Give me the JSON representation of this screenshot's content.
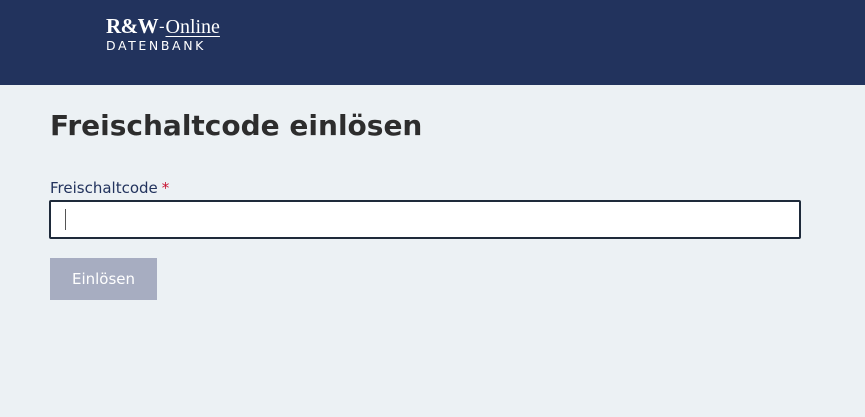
{
  "header": {
    "logo": {
      "mark": "R&W",
      "dash": "-",
      "online": "Online",
      "subtitle": "DATENBANK"
    },
    "background_color": "#22335d"
  },
  "main": {
    "title": "Freischaltcode einlösen",
    "form": {
      "code_label": "Freischaltcode",
      "required_marker": "*",
      "code_value": "",
      "code_placeholder": "",
      "submit_label": "Einlösen",
      "submit_disabled": true
    }
  },
  "colors": {
    "page_background": "#ecf1f4",
    "label_color": "#22335d",
    "required_color": "#c8102e",
    "button_disabled": "#a7adc1"
  }
}
